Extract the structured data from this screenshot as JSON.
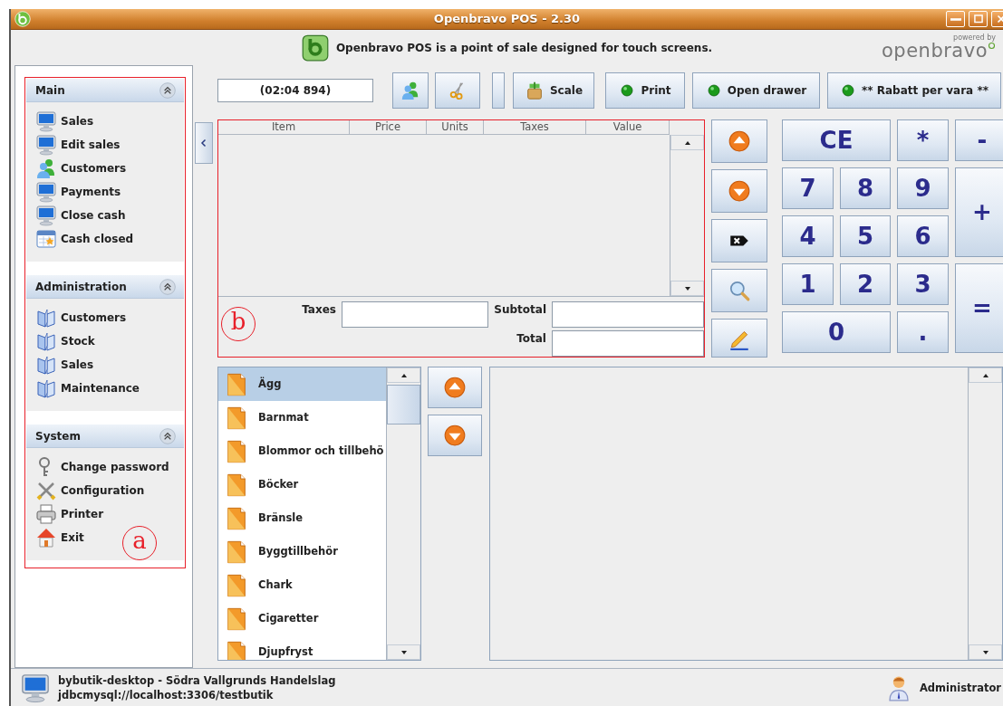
{
  "window": {
    "title": "Openbravo POS - 2.30"
  },
  "banner": {
    "message": "Openbravo POS is a point of sale designed for touch screens.",
    "powered_by": "powered by",
    "brand": "openbravo"
  },
  "sidebar": {
    "sections": [
      {
        "title": "Main",
        "expanded": true,
        "items": [
          {
            "label": "Sales",
            "kind": "monitor"
          },
          {
            "label": "Edit sales",
            "kind": "monitor"
          },
          {
            "label": "Customers",
            "kind": "people"
          },
          {
            "label": "Payments",
            "kind": "monitor"
          },
          {
            "label": "Close cash",
            "kind": "monitor"
          },
          {
            "label": "Cash closed",
            "kind": "calendar"
          }
        ]
      },
      {
        "title": "Administration",
        "expanded": true,
        "items": [
          {
            "label": "Customers",
            "kind": "book"
          },
          {
            "label": "Stock",
            "kind": "book"
          },
          {
            "label": "Sales",
            "kind": "book"
          },
          {
            "label": "Maintenance",
            "kind": "book"
          }
        ]
      },
      {
        "title": "System",
        "expanded": true,
        "items": [
          {
            "label": "Change password",
            "kind": "keys"
          },
          {
            "label": "Configuration",
            "kind": "tools"
          },
          {
            "label": "Printer",
            "kind": "printer"
          },
          {
            "label": "Exit",
            "kind": "house"
          }
        ]
      }
    ]
  },
  "annotations": [
    {
      "label": "a"
    },
    {
      "label": "b"
    }
  ],
  "toolbar": {
    "ticket_id": "(02:04 894)",
    "buttons": [
      {
        "kind": "customer"
      },
      {
        "kind": "cut"
      },
      {
        "kind": "blank"
      },
      {
        "kind": "scale",
        "label": "Scale"
      },
      {
        "kind": "light",
        "label": "Print"
      },
      {
        "kind": "light",
        "label": "Open drawer"
      },
      {
        "kind": "light",
        "label": "** Rabatt per vara **"
      }
    ]
  },
  "ticket": {
    "columns": [
      "Item",
      "Price",
      "Units",
      "Taxes",
      "Value"
    ],
    "totals": [
      {
        "label": "Taxes"
      },
      {
        "label": "Subtotal"
      },
      {
        "label": "Total"
      }
    ]
  },
  "actions": [
    {
      "kind": "up"
    },
    {
      "kind": "down"
    },
    {
      "kind": "delete"
    },
    {
      "kind": "search"
    },
    {
      "kind": "edit"
    }
  ],
  "keypad": [
    {
      "label": "CE"
    },
    {
      "label": "*"
    },
    {
      "label": "-"
    },
    {
      "label": "7"
    },
    {
      "label": "8"
    },
    {
      "label": "9"
    },
    {
      "label": "+"
    },
    {
      "label": "4"
    },
    {
      "label": "5"
    },
    {
      "label": "6"
    },
    {
      "label": "1"
    },
    {
      "label": "2"
    },
    {
      "label": "3"
    },
    {
      "label": "="
    },
    {
      "label": "0"
    },
    {
      "label": "."
    }
  ],
  "categories": {
    "items": [
      {
        "label": "Ägg",
        "selected": true
      },
      {
        "label": "Barnmat",
        "selected": false
      },
      {
        "label": "Blommor och tillbehö",
        "selected": false
      },
      {
        "label": "Böcker",
        "selected": false
      },
      {
        "label": "Bränsle",
        "selected": false
      },
      {
        "label": "Byggtillbehör",
        "selected": false
      },
      {
        "label": "Chark",
        "selected": false
      },
      {
        "label": "Cigaretter",
        "selected": false
      },
      {
        "label": "Djupfryst",
        "selected": false
      }
    ]
  },
  "status_bar": {
    "host": "bybutik-desktop - Södra Vallgrunds Handelslag",
    "database": "jdbcmysql://localhost:3306/testbutik",
    "user": "Administrator"
  }
}
